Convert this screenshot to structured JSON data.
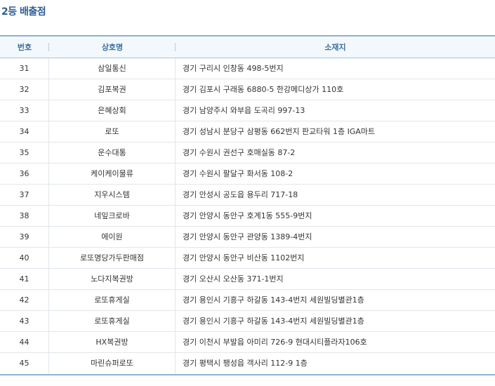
{
  "page": {
    "title": "2등 배출점"
  },
  "table": {
    "headers": {
      "no": "번호",
      "name": "상호명",
      "address": "소재지"
    },
    "rows": [
      {
        "no": "31",
        "name": "삼일통신",
        "address": "경기 구리시 인창동 498-5번지"
      },
      {
        "no": "32",
        "name": "김포복권",
        "address": "경기 김포시 구래동 6880-5 한강메디상가 110호"
      },
      {
        "no": "33",
        "name": "은혜상회",
        "address": "경기 남양주시 와부읍 도곡리 997-13"
      },
      {
        "no": "34",
        "name": "로또",
        "address": "경기 성남시 분당구 삼평동 662번지 판교타워 1층 IGA마트"
      },
      {
        "no": "35",
        "name": "운수대통",
        "address": "경기 수원시 권선구 호매실동 87-2"
      },
      {
        "no": "36",
        "name": "케이케이물류",
        "address": "경기 수원시 팔달구 화서동 108-2"
      },
      {
        "no": "37",
        "name": "지우시스템",
        "address": "경기 안성시 공도읍 용두리 717-18"
      },
      {
        "no": "38",
        "name": "네잎크로바",
        "address": "경기 안양시 동안구 호계1동 555-9번지"
      },
      {
        "no": "39",
        "name": "에이원",
        "address": "경기 안양시 동안구 관양동 1389-4번지"
      },
      {
        "no": "40",
        "name": "로또명당가두판매점",
        "address": "경기 안양시 동안구 비산동 1102번지"
      },
      {
        "no": "41",
        "name": "노다지복권방",
        "address": "경기 오산시 오산동 371-1번지"
      },
      {
        "no": "42",
        "name": "로또휴게실",
        "address": "경기 용인시 기흥구 하갈동 143-4번지 세원빌딩별관1층"
      },
      {
        "no": "43",
        "name": "로또휴게실",
        "address": "경기 용인시 기흥구 하갈동 143-4번지 세원빌딩별관1층"
      },
      {
        "no": "44",
        "name": "HX복권방",
        "address": "경기 이천시 부발읍 아미리 726-9 현대시티플라자106호"
      },
      {
        "no": "45",
        "name": "마린슈퍼로또",
        "address": "경기 평택시 팽성읍 객사리 112-9 1층"
      }
    ]
  }
}
